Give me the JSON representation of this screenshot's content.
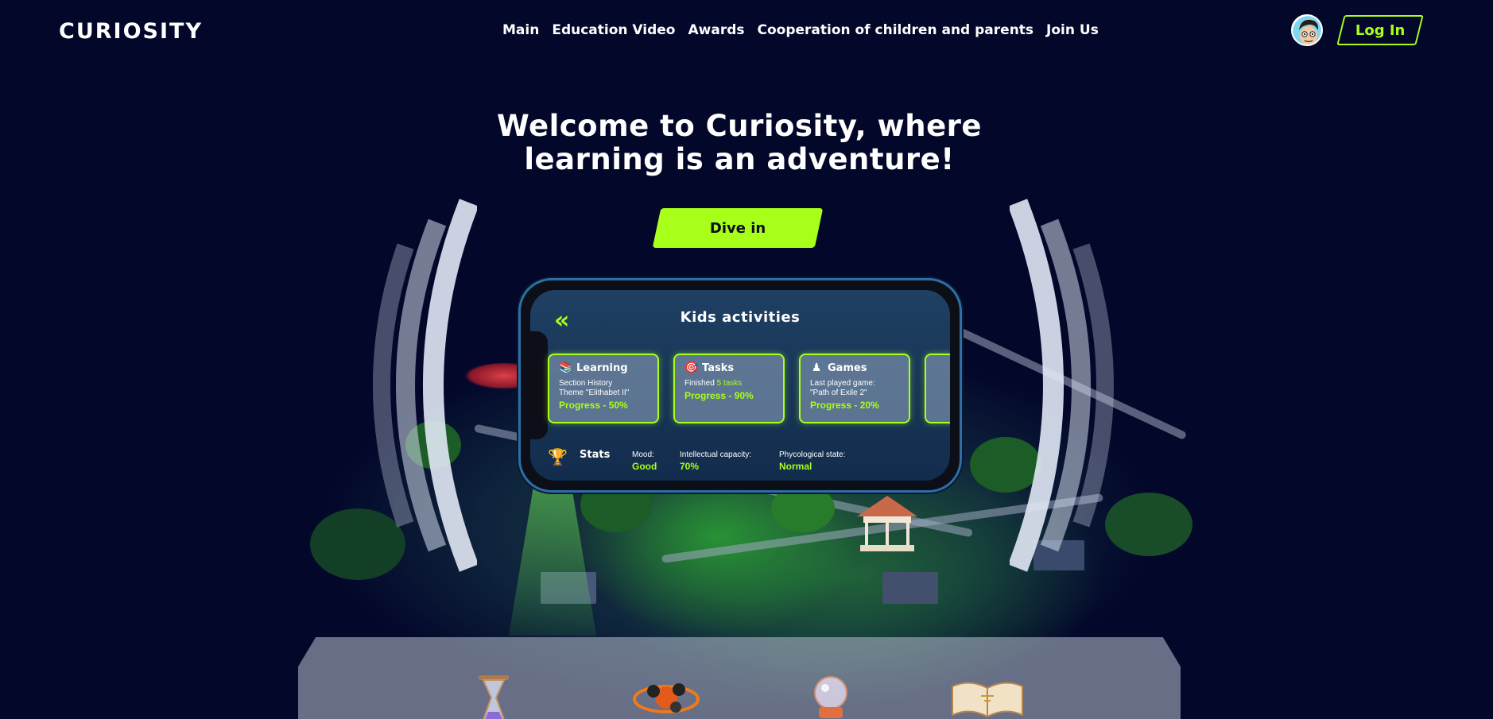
{
  "header": {
    "logo": "CURIOSITY",
    "nav": [
      "Main",
      "Education Video",
      "Awards",
      "Cooperation of children and parents",
      "Join Us"
    ],
    "login_label": "Log In"
  },
  "hero": {
    "title_line1": "Welcome to Curiosity, where",
    "title_line2": "learning is an adventure!",
    "cta_label": "Dive in"
  },
  "phone": {
    "title": "Kids activities",
    "back_glyph": "«",
    "cards": [
      {
        "title": "Learning",
        "icon": "books-icon",
        "line1": "Section History",
        "line2": "Theme \"Elithabet II\"",
        "progress": "Progress - 50%"
      },
      {
        "title": "Tasks",
        "icon": "target-icon",
        "line1_prefix": "Finished ",
        "line1_highlight": "5 tasks",
        "progress": "Progress - 90%"
      },
      {
        "title": "Games",
        "icon": "chess-pawn-icon",
        "line1": "Last played game:",
        "line2": "\"Path of Exile 2\"",
        "progress": "Progress - 20%"
      }
    ],
    "stats": {
      "label": "Stats",
      "items": [
        {
          "key": "Mood:",
          "value": "Good"
        },
        {
          "key": "Intellectual capacity:",
          "value": "70%"
        },
        {
          "key": "Phycological state:",
          "value": "Normal"
        }
      ]
    }
  },
  "colors": {
    "accent": "#a8ff1a",
    "background": "#03072a",
    "phone_border": "#2c6fa8"
  }
}
